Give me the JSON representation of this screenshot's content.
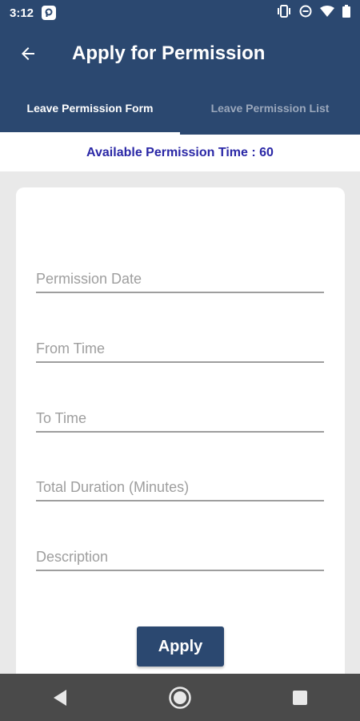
{
  "status_bar": {
    "time": "3:12",
    "icons": [
      "notification-p-icon",
      "vibrate-icon",
      "do-not-disturb-icon",
      "wifi-icon",
      "battery-icon"
    ]
  },
  "app_bar": {
    "title": "Apply for Permission",
    "back_icon": "back-arrow-icon"
  },
  "tabs": [
    {
      "label": "Leave Permission Form",
      "active": true
    },
    {
      "label": "Leave Permission List",
      "active": false
    }
  ],
  "availability": {
    "text": "Available Permission Time : 60"
  },
  "form": {
    "fields": [
      {
        "placeholder": "Permission Date",
        "value": ""
      },
      {
        "placeholder": "From Time",
        "value": ""
      },
      {
        "placeholder": "To Time",
        "value": ""
      },
      {
        "placeholder": "Total Duration (Minutes)",
        "value": ""
      },
      {
        "placeholder": "Description",
        "value": ""
      }
    ],
    "submit_label": "Apply"
  },
  "nav_bar": {
    "icons": [
      "back-triangle-icon",
      "home-circle-icon",
      "recents-square-icon"
    ]
  },
  "colors": {
    "primary": "#2b4870",
    "accent_text": "#2a27a6",
    "background": "#e9e9e9",
    "nav_bar": "#4a4a4a"
  }
}
